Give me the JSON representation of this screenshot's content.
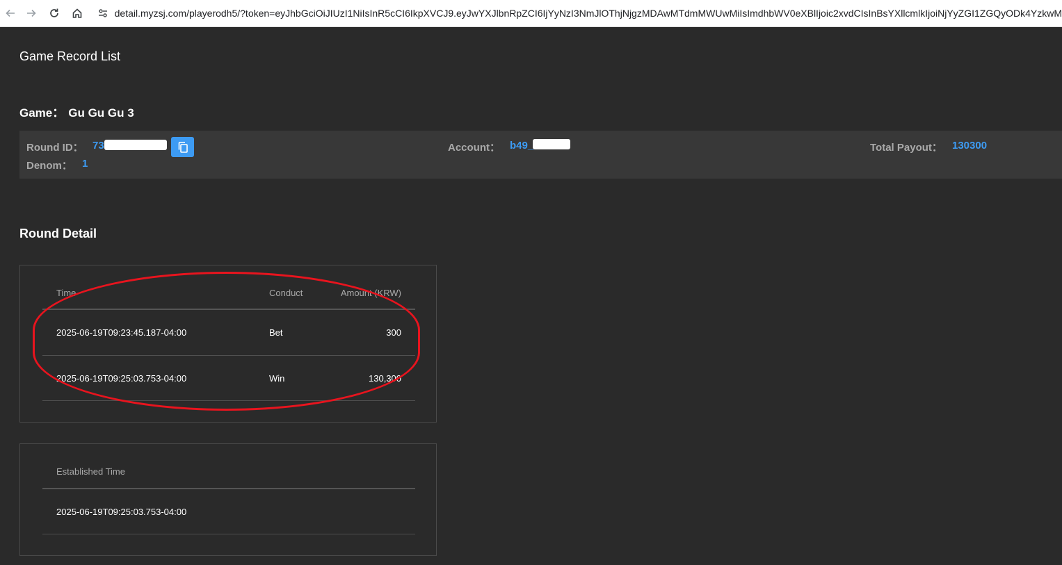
{
  "browser": {
    "url": "detail.myzsj.com/playerodh5/?token=eyJhbGciOiJIUzI1NiIsInR5cCI6IkpXVCJ9.eyJwYXJlbnRpZCI6IjYyNzI3NmJlOThjNjgzMDAwMTdmMWUwMiIsImdhbWV0eXBlIjoic2xvdCIsInBsYXllcmlkIjoiNjYyZGI1ZGQyODk4YzkwM"
  },
  "page": {
    "title": "Game Record List"
  },
  "game": {
    "label": "Game：",
    "name": "Gu Gu Gu 3"
  },
  "summary": {
    "round_id_label": "Round ID：",
    "round_id_value": "73",
    "account_label": "Account：",
    "account_value": "b49_",
    "total_payout_label": "Total Payout：",
    "total_payout_value": "130300",
    "denom_label": "Denom：",
    "denom_value": "1"
  },
  "round_detail": {
    "title": "Round Detail",
    "columns": [
      "Time",
      "Conduct",
      "Amount (KRW)"
    ],
    "rows": [
      {
        "time": "2025-06-19T09:23:45.187-04:00",
        "conduct": "Bet",
        "amount": "300"
      },
      {
        "time": "2025-06-19T09:25:03.753-04:00",
        "conduct": "Win",
        "amount": "130,300"
      }
    ]
  },
  "established": {
    "column": "Established Time",
    "value": "2025-06-19T09:25:03.753-04:00"
  },
  "colors": {
    "background": "#2a2a2a",
    "panel": "#383838",
    "accent": "#3d9bf3",
    "highlight": "#e8141e"
  },
  "icons": [
    "back-arrow-icon",
    "forward-arrow-icon",
    "reload-icon",
    "home-icon",
    "site-info-icon",
    "copy-icon"
  ]
}
